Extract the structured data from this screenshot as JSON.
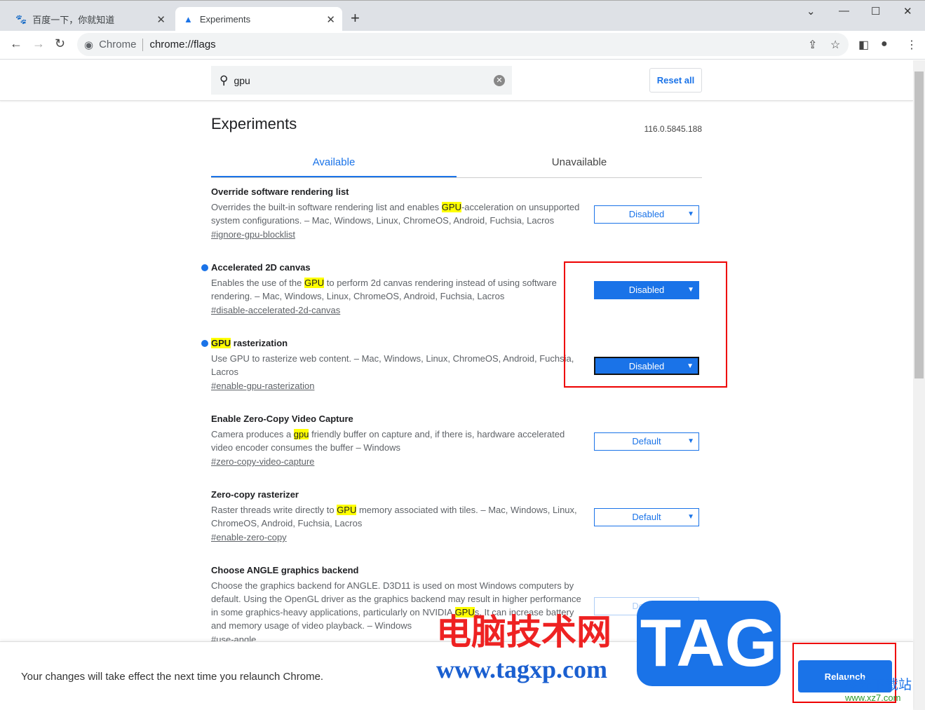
{
  "browser": {
    "tabs": [
      {
        "title": "百度一下，你就知道",
        "icon": "baidu-paw-icon"
      },
      {
        "title": "Experiments",
        "icon": "flask-icon"
      }
    ],
    "omnibox": {
      "site": "Chrome",
      "url": "chrome://flags"
    }
  },
  "search": {
    "value": "gpu",
    "reset_label": "Reset all"
  },
  "page": {
    "title": "Experiments",
    "version": "116.0.5845.188",
    "tabs": [
      "Available",
      "Unavailable"
    ]
  },
  "experiments": [
    {
      "name": [
        {
          "t": "Override software rendering list"
        }
      ],
      "desc": [
        {
          "t": "Overrides the built-in software rendering list and enables "
        },
        {
          "t": "GPU",
          "hl": true
        },
        {
          "t": "-acceleration on unsupported system configurations. – Mac, Windows, Linux, ChromeOS, Android, Fuchsia, Lacros"
        }
      ],
      "link": "#ignore-gpu-blocklist",
      "value": "Disabled",
      "modified": false
    },
    {
      "name": [
        {
          "t": "Accelerated 2D canvas"
        }
      ],
      "desc": [
        {
          "t": "Enables the use of the "
        },
        {
          "t": "GPU",
          "hl": true
        },
        {
          "t": " to perform 2d canvas rendering instead of using software rendering. – Mac, Windows, Linux, ChromeOS, Android, Fuchsia, Lacros"
        }
      ],
      "link": "#disable-accelerated-2d-canvas",
      "value": "Disabled",
      "modified": true
    },
    {
      "name": [
        {
          "t": "GPU",
          "hl": true
        },
        {
          "t": " rasterization"
        }
      ],
      "desc": [
        {
          "t": "Use GPU to rasterize web content. – Mac, Windows, Linux, ChromeOS, Android, Fuchsia, Lacros"
        }
      ],
      "link": "#enable-gpu-rasterization",
      "value": "Disabled",
      "modified": true
    },
    {
      "name": [
        {
          "t": "Enable Zero-Copy Video Capture"
        }
      ],
      "desc": [
        {
          "t": "Camera produces a "
        },
        {
          "t": "gpu",
          "hl": true
        },
        {
          "t": " friendly buffer on capture and, if there is, hardware accelerated video encoder consumes the buffer – Windows"
        }
      ],
      "link": "#zero-copy-video-capture",
      "value": "Default",
      "modified": false
    },
    {
      "name": [
        {
          "t": "Zero-copy rasterizer"
        }
      ],
      "desc": [
        {
          "t": "Raster threads write directly to "
        },
        {
          "t": "GPU",
          "hl": true
        },
        {
          "t": " memory associated with tiles. – Mac, Windows, Linux, ChromeOS, Android, Fuchsia, Lacros"
        }
      ],
      "link": "#enable-zero-copy",
      "value": "Default",
      "modified": false
    },
    {
      "name": [
        {
          "t": "Choose ANGLE graphics backend"
        }
      ],
      "desc": [
        {
          "t": "Choose the graphics backend for ANGLE. D3D11 is used on most Windows computers by default. Using the OpenGL driver as the graphics backend may result in higher performance in some graphics-heavy applications, particularly on NVIDIA "
        },
        {
          "t": "GPU",
          "hl": true
        },
        {
          "t": "s. It can increase battery and memory usage of video playback. – Windows"
        }
      ],
      "link": "#use-angle",
      "value": "Default",
      "modified": false
    }
  ],
  "footer": {
    "message": "Your changes will take effect the next time you relaunch Chrome.",
    "relaunch_label": "Relaunch"
  },
  "watermark": {
    "cn": "电脑技术网",
    "url": "www.tagxp.com",
    "tag": "TAG",
    "site2": "极光下载站",
    "url2": "www.xz7.com"
  },
  "colors": {
    "accent": "#1a73e8",
    "highlight": "#ffff00",
    "annotation": "#ee0000"
  }
}
